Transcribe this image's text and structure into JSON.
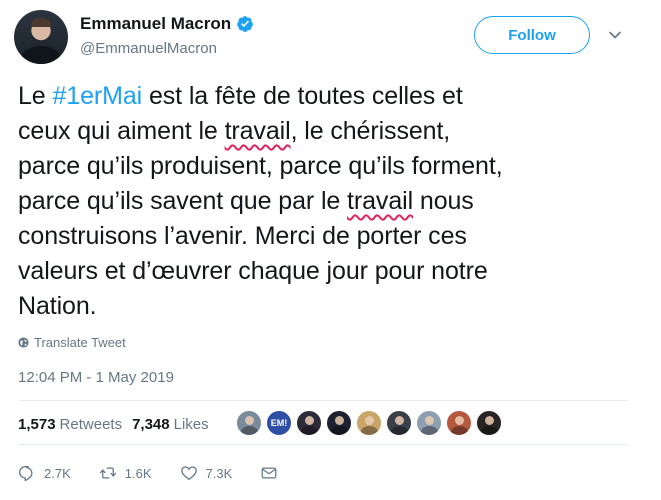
{
  "header": {
    "display_name": "Emmanuel Macron",
    "handle": "@EmmanuelMacron",
    "follow_label": "Follow"
  },
  "tweet": {
    "lines": [
      [
        "Le ",
        "#1erMai",
        " est la fête de toutes celles et"
      ],
      [
        "ceux qui aiment le ",
        "travail",
        ", le chérissent,"
      ],
      [
        "parce qu’ils produisent, parce qu’ils forment,"
      ],
      [
        "parce qu’ils savent que par le ",
        "travail",
        " nous"
      ],
      [
        "construisons l’avenir. Merci de porter ces"
      ],
      [
        "valeurs et d’œuvrer chaque jour pour notre"
      ],
      [
        "Nation."
      ]
    ]
  },
  "translate_label": "Translate Tweet",
  "timestamp": "12:04 PM - 1 May 2019",
  "stats": {
    "retweets_count": "1,573",
    "retweets_label": "Retweets",
    "likes_count": "7,348",
    "likes_label": "Likes"
  },
  "likers": {
    "em_label": "EM!",
    "colors": [
      "#7a8b9b",
      "#2e4fa3",
      "#2d2a3a",
      "#1e2230",
      "#c9a56a",
      "#3b3f4a",
      "#8e9fb1",
      "#b4583f",
      "#2a2525"
    ]
  },
  "actions": {
    "reply_count": "2.7K",
    "retweet_count": "1.6K",
    "like_count": "7.3K"
  },
  "colors": {
    "accent": "#1da1f2",
    "muted": "#657786",
    "spell_underline": "#e0245e"
  }
}
